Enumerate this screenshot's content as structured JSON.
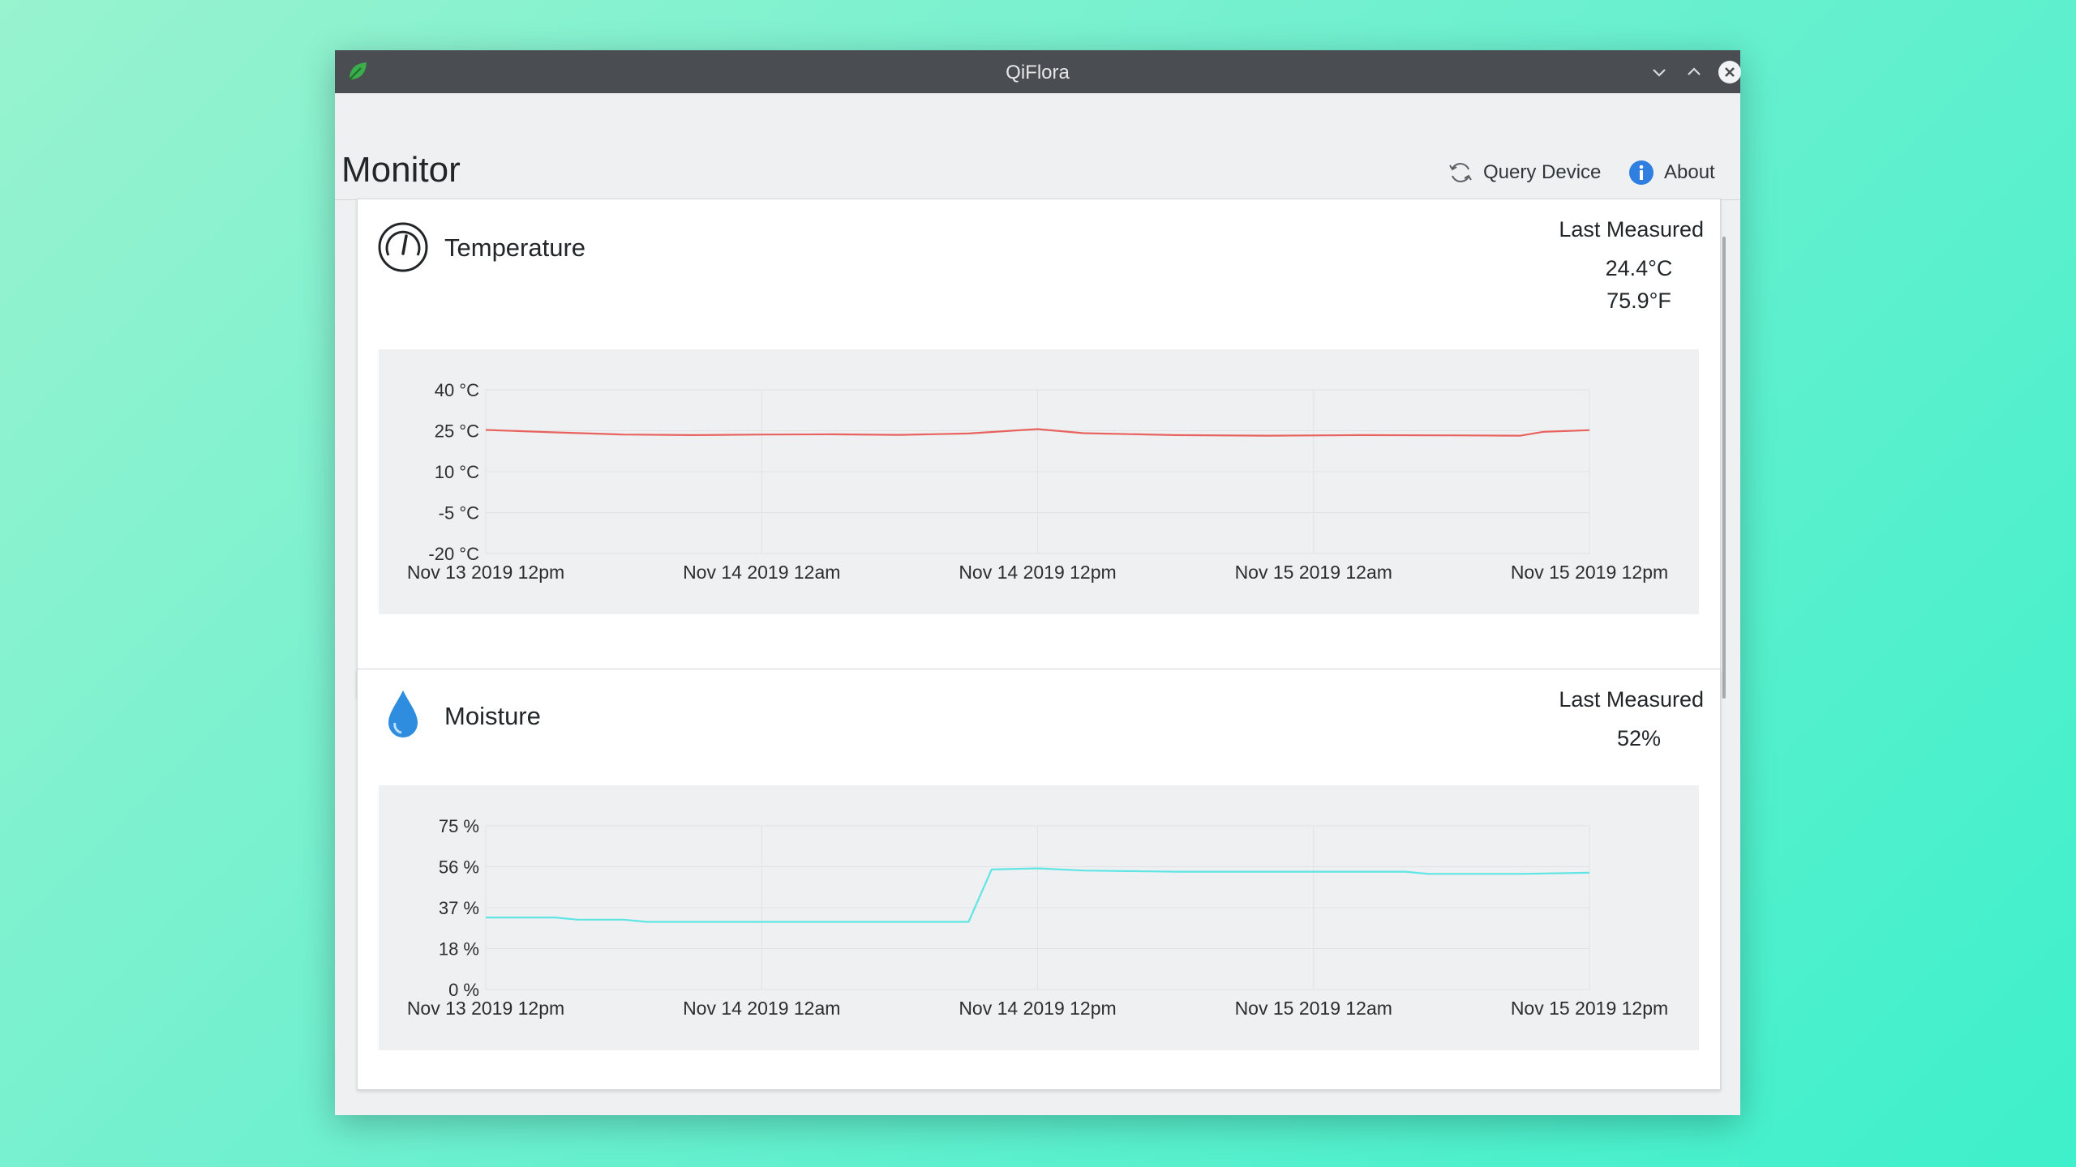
{
  "window": {
    "title": "QiFlora",
    "page_title": "Monitor"
  },
  "toolbar": {
    "query_label": "Query Device",
    "about_label": "About"
  },
  "temperature": {
    "title": "Temperature",
    "last_label": "Last Measured",
    "value_c": "24.4°C",
    "value_f": "75.9°F"
  },
  "moisture": {
    "title": "Moisture",
    "last_label": "Last Measured",
    "value": "52%"
  },
  "colors": {
    "temperature_line": "#e8625f",
    "moisture_line": "#5fe6e4",
    "leaf": "#3aae4c",
    "drop": "#2f8de0",
    "about": "#2f7fe0"
  },
  "icons": {
    "app": "leaf-icon",
    "minimize": "chevron-down-icon",
    "maximize": "chevron-up-icon",
    "close": "close-icon",
    "query": "refresh-icon",
    "about": "info-icon",
    "temperature": "gauge-icon",
    "moisture": "water-drop-icon"
  },
  "chart_data": [
    {
      "type": "line",
      "x_labels": [
        "Nov 13 2019 12pm",
        "Nov 14 2019 12am",
        "Nov 14 2019 12pm",
        "Nov 15 2019 12am",
        "Nov 15 2019 12pm"
      ],
      "y_labels": [
        "40 °C",
        "25 °C",
        "10 °C",
        "-5 °C",
        "-20 °C"
      ],
      "ylim": [
        -20,
        40
      ],
      "xlim": [
        0,
        48
      ],
      "grid": true,
      "series": [
        {
          "color": "#e8625f",
          "points": [
            [
              0,
              25.3
            ],
            [
              3,
              24.4
            ],
            [
              6,
              23.6
            ],
            [
              9,
              23.4
            ],
            [
              12,
              23.6
            ],
            [
              15,
              23.7
            ],
            [
              18,
              23.5
            ],
            [
              21,
              24.0
            ],
            [
              24,
              25.6
            ],
            [
              26,
              24.1
            ],
            [
              30,
              23.4
            ],
            [
              34,
              23.2
            ],
            [
              38,
              23.4
            ],
            [
              42,
              23.3
            ],
            [
              45,
              23.2
            ],
            [
              46,
              24.6
            ],
            [
              48,
              25.2
            ]
          ]
        }
      ]
    },
    {
      "type": "line",
      "x_labels": [
        "Nov 13 2019 12pm",
        "Nov 14 2019 12am",
        "Nov 14 2019 12pm",
        "Nov 15 2019 12am",
        "Nov 15 2019 12pm"
      ],
      "y_labels": [
        "75 %",
        "56 %",
        "37 %",
        "18 %",
        "0 %"
      ],
      "ylim": [
        0,
        75
      ],
      "xlim": [
        0,
        48
      ],
      "grid": true,
      "series": [
        {
          "color": "#5fe6e4",
          "points": [
            [
              0,
              33
            ],
            [
              3,
              33
            ],
            [
              4,
              32
            ],
            [
              6,
              32
            ],
            [
              7,
              31
            ],
            [
              12,
              31
            ],
            [
              18,
              31
            ],
            [
              21,
              31
            ],
            [
              22,
              55
            ],
            [
              24,
              55.5
            ],
            [
              26,
              54.5
            ],
            [
              30,
              54
            ],
            [
              36,
              54
            ],
            [
              40,
              54
            ],
            [
              41,
              53
            ],
            [
              45,
              53
            ],
            [
              48,
              53.5
            ]
          ]
        }
      ]
    }
  ]
}
